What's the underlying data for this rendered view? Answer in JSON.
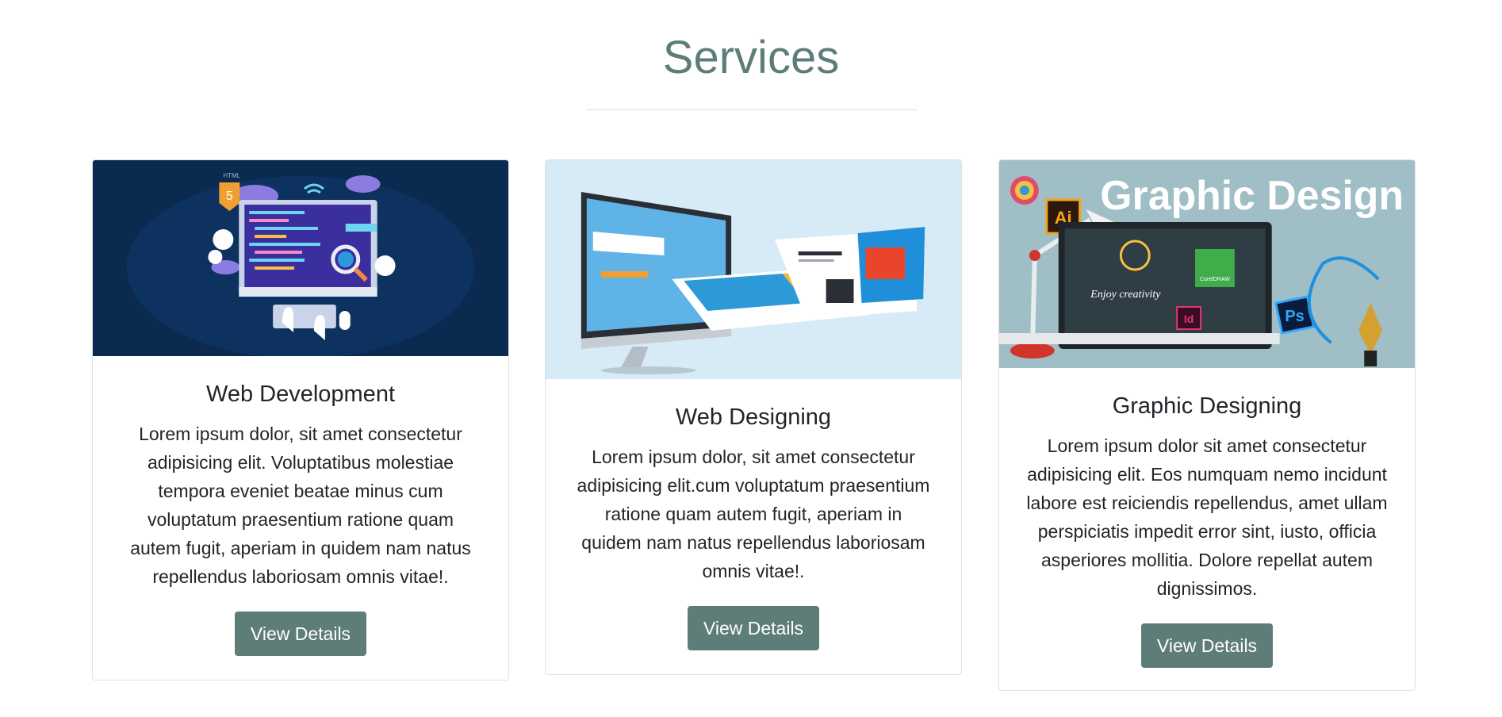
{
  "section": {
    "title": "Services"
  },
  "cards": [
    {
      "title": "Web Development",
      "text": "Lorem ipsum dolor, sit amet consectetur adipisicing elit. Voluptatibus molestiae tempora eveniet beatae minus cum voluptatum praesentium ratione quam autem fugit, aperiam in quidem nam natus repellendus laboriosam omnis vitae!.",
      "button": "View Details",
      "image": {
        "label": "web-development-illustration",
        "html_badge": "HTML",
        "html_version": "5"
      }
    },
    {
      "title": "Web Designing",
      "text": "Lorem ipsum dolor, sit amet consectetur adipisicing elit.cum voluptatum praesentium ratione quam autem fugit, aperiam in quidem nam natus repellendus laboriosam omnis vitae!.",
      "button": "View Details",
      "image": {
        "label": "web-design-monitor-illustration"
      }
    },
    {
      "title": "Graphic Designing",
      "text": "Lorem ipsum dolor sit amet consectetur adipisicing elit. Eos numquam nemo incidunt labore est reiciendis repellendus, amet ullam perspiciatis impedit error sint, iusto, officia asperiores mollitia. Dolore repellat autem dignissimos.",
      "button": "View Details",
      "image": {
        "label": "graphic-design-illustration",
        "banner": "Graphic Design",
        "screen_text": "Enjoy creativity",
        "ai_badge": "Ai",
        "ps_badge": "Ps",
        "id_badge": "Id",
        "corel_badge": "CorelDRAW"
      }
    }
  ],
  "colors": {
    "accent": "#5e7d78",
    "dev_bg": "#0b2a4f",
    "design_bg": "#d6ebf6",
    "graphic_bg": "#9fbec6"
  }
}
